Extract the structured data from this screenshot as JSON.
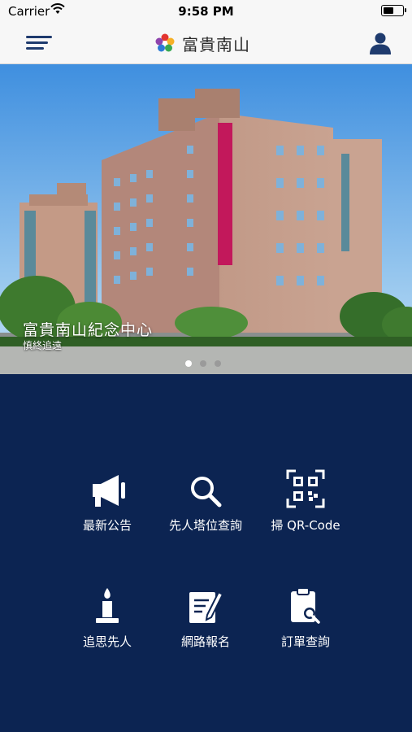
{
  "status_bar": {
    "carrier": "Carrier",
    "time": "9:58 PM"
  },
  "header": {
    "title": "富貴南山",
    "icons": [
      "menu-icon",
      "logo-icon",
      "user-icon"
    ]
  },
  "hero": {
    "caption": "富貴南山紀念中心",
    "subcaption": "慎終追遠",
    "page_count": 3,
    "active_page": 1
  },
  "menu": {
    "items": [
      {
        "label": "最新公告",
        "icon": "megaphone-icon"
      },
      {
        "label": "先人塔位查詢",
        "icon": "search-icon"
      },
      {
        "label": "掃 QR-Code",
        "icon": "qr-code-icon"
      },
      {
        "label": "追思先人",
        "icon": "candle-icon"
      },
      {
        "label": "網路報名",
        "icon": "form-edit-icon"
      },
      {
        "label": "訂單查詢",
        "icon": "order-search-icon"
      }
    ]
  },
  "colors": {
    "background": "#0c2452",
    "navbar": "#f7f7f7",
    "accent": "#1f3b6e"
  }
}
